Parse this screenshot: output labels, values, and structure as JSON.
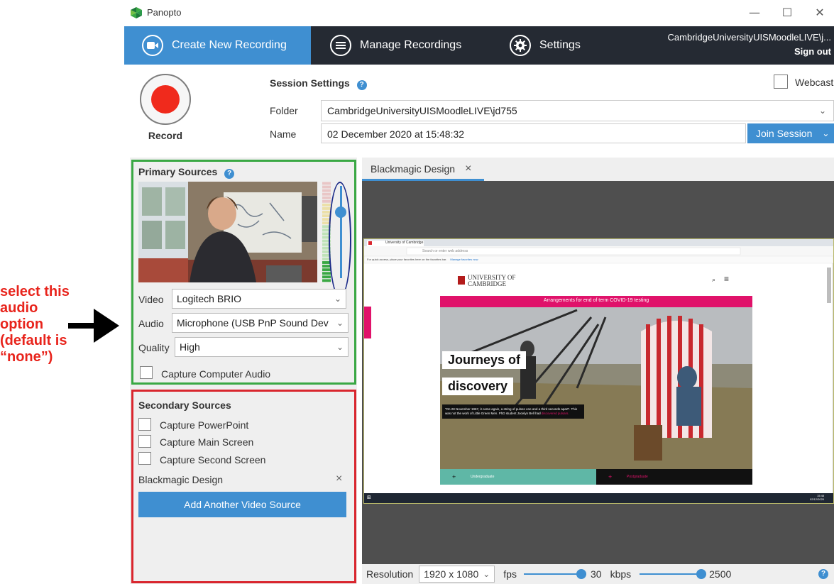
{
  "annotation": {
    "text_lines": [
      "select this",
      "audio",
      "option",
      "(default is",
      "“none”)"
    ]
  },
  "app": {
    "title": "Panopto"
  },
  "window_controls": {
    "minimize": "—",
    "maximize": "☐",
    "close": "✕"
  },
  "tabs": [
    {
      "label": "Create New Recording",
      "icon": "video-camera-icon"
    },
    {
      "label": "Manage Recordings",
      "icon": "list-icon"
    },
    {
      "label": "Settings",
      "icon": "gear-icon"
    }
  ],
  "user": {
    "name": "CambridgeUniversityUISMoodleLIVE\\j...",
    "sign_out": "Sign out"
  },
  "record": {
    "label": "Record"
  },
  "session": {
    "title": "Session Settings",
    "help": "?",
    "folder_label": "Folder",
    "folder_value": "CambridgeUniversityUISMoodleLIVE\\jd755",
    "name_label": "Name",
    "name_value": "02 December 2020 at 15:48:32",
    "join_label": "Join Session",
    "webcast_label": "Webcast"
  },
  "primary": {
    "title": "Primary Sources",
    "help": "?",
    "video_label": "Video",
    "video_value": "Logitech BRIO",
    "audio_label": "Audio",
    "audio_value": "Microphone (USB PnP Sound Dev",
    "quality_label": "Quality",
    "quality_value": "High",
    "capture_audio_label": "Capture Computer Audio",
    "audio_level": 0.22
  },
  "secondary": {
    "title": "Secondary Sources",
    "items": [
      "Capture PowerPoint",
      "Capture Main Screen",
      "Capture Second Screen"
    ],
    "source_name": "Blackmagic Design",
    "remove": "×",
    "add_button": "Add Another Video Source"
  },
  "preview": {
    "tab_label": "Blackmagic Design",
    "tab_close": "×",
    "site": {
      "tab_title": "University of Cambridge",
      "address": "Search or enter web address",
      "favorites_bar": "For quick access, place your favorites here on the favorites bar.",
      "favorites_link": "Manage favorites now",
      "logo_line1": "UNIVERSITY OF",
      "logo_line2": "CAMBRIDGE",
      "banner": "Arrangements for end of term COVID-19 testing",
      "headline1": "Journeys of",
      "headline2": "discovery",
      "blurb": "“On 28 November 1967, it came again, a string of pulses one and a third seconds apart”. This was not the work of Little Green Men. PhD student Jocelyn Bell had",
      "blurb_link": "discovered pulsars.",
      "undergrad": "Undergraduate",
      "postgrad": "Postgraduate",
      "clock": "15:48",
      "date": "02/12/2020"
    }
  },
  "bottom": {
    "resolution_label": "Resolution",
    "resolution_value": "1920 x 1080",
    "fps_label": "fps",
    "fps_value": "30",
    "kbps_label": "kbps",
    "kbps_value": "2500",
    "help": "?"
  },
  "colors": {
    "accent": "#3f8fd1",
    "tabbar": "#252a33",
    "record": "#f02a1c",
    "primary_border": "#3aa844",
    "secondary_border": "#d9262e",
    "annotation": "#e8241c",
    "banner": "#e0126a"
  }
}
